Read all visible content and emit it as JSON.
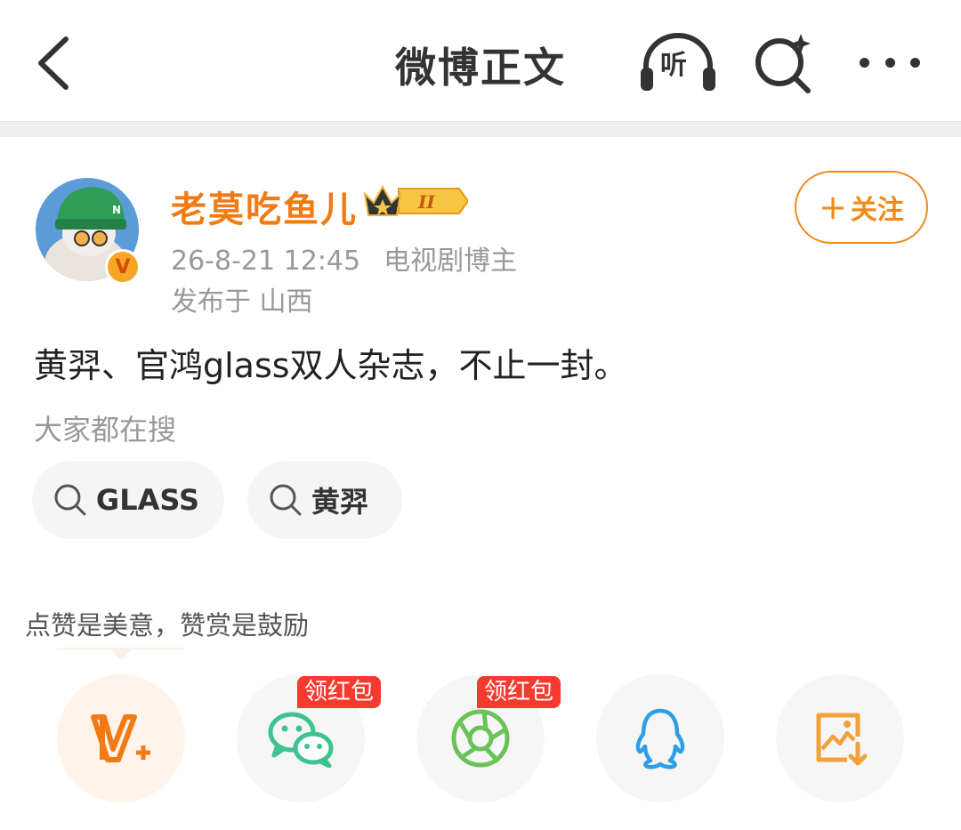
{
  "nav": {
    "title": "微博正文",
    "listen_label": "听"
  },
  "post": {
    "author": "老莫吃鱼儿",
    "level_badge": "II",
    "time": "26-8-21 12:45",
    "category": "电视剧博主",
    "location": "发布于 山西",
    "follow_label": "关注",
    "text": "黄羿、官鸿glass双人杂志，不止一封。"
  },
  "hot_search": {
    "label": "大家都在搜",
    "chips": [
      "GLASS",
      "黄羿"
    ]
  },
  "reward": {
    "tip": "点赞是美意，赞赏是鼓励"
  },
  "share": {
    "red_tag": "领红包"
  },
  "colors": {
    "accent": "#f07b14",
    "red_tag": "#f53a2f",
    "wechat": "#3ec28f",
    "moments": "#6ac259",
    "qq": "#2e9ee8",
    "save": "#f2a13a"
  }
}
